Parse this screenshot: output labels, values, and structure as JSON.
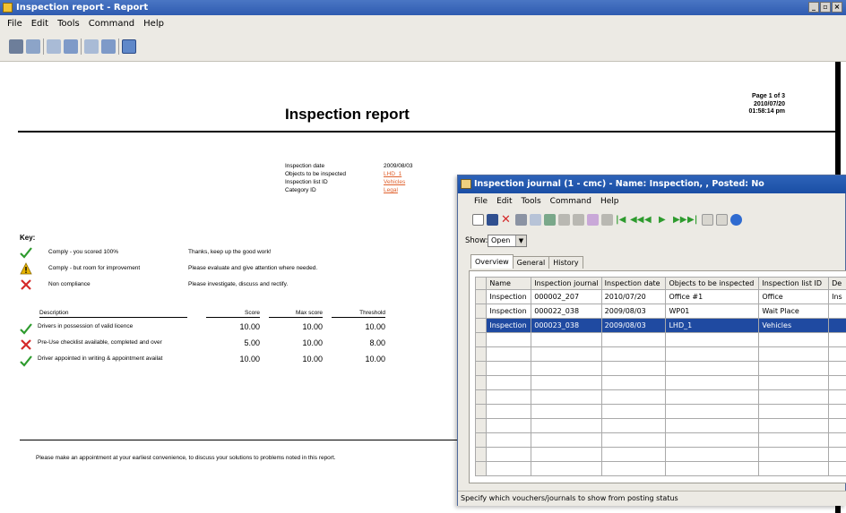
{
  "report_window": {
    "title": "Inspection report - Report",
    "menu": [
      "File",
      "Edit",
      "Tools",
      "Command",
      "Help"
    ],
    "report": {
      "title": "Inspection report",
      "page_info": [
        "Page 1 of  3",
        "2010/07/20",
        "01:58:14 pm"
      ],
      "meta": [
        {
          "label": "Inspection date",
          "value": "2009/08/03",
          "link": false
        },
        {
          "label": "Objects to be inspected",
          "value": "LHD_1",
          "link": true
        },
        {
          "label": "Inspection list ID",
          "value": "Vehicles",
          "link": true
        },
        {
          "label": "Category ID",
          "value": "Legal",
          "link": true
        }
      ],
      "key_title": "Key:",
      "key": [
        {
          "icon": "check-icon",
          "label": "Comply - you scored 100%",
          "desc": "Thanks, keep up the good work!"
        },
        {
          "icon": "warning-icon",
          "label": "Comply - but room for improvement",
          "desc": "Please evaluate and give attention where needed."
        },
        {
          "icon": "x-icon",
          "label": "Non compliance",
          "desc": "Please investigate, discuss and rectify."
        }
      ],
      "score_headers": {
        "description": "Description",
        "score": "Score",
        "max": "Max score",
        "threshold": "Threshold"
      },
      "scores": [
        {
          "icon": "check-icon",
          "description": "Drivers in possession of valid licence",
          "score": "10.00",
          "max": "10.00",
          "threshold": "10.00"
        },
        {
          "icon": "x-icon",
          "description": "Pre-Use checklist available, completed and over",
          "score": "5.00",
          "max": "10.00",
          "threshold": "8.00"
        },
        {
          "icon": "check-icon",
          "description": "Driver appointed in writing & appointment availat",
          "score": "10.00",
          "max": "10.00",
          "threshold": "10.00"
        }
      ],
      "footer": "Please make an appointment at your earliest convenience, to discuss your solutions to problems noted in this report."
    }
  },
  "journal_window": {
    "title": "Inspection journal (1 - cmc) - Name: Inspection, , Posted: No",
    "menu": [
      "File",
      "Edit",
      "Tools",
      "Command",
      "Help"
    ],
    "show_label": "Show:",
    "show_value": "Open",
    "tabs": [
      "Overview",
      "General",
      "History"
    ],
    "columns": [
      "Name",
      "Inspection journal",
      "Inspection date",
      "Objects to be inspected",
      "Inspection list ID",
      "De"
    ],
    "rows": [
      [
        "Inspection",
        "000002_207",
        "2010/07/20",
        "Office #1",
        "Office",
        "Ins"
      ],
      [
        "Inspection",
        "000022_038",
        "2009/08/03",
        "WP01",
        "Wait Place",
        ""
      ],
      [
        "Inspection",
        "000023_038",
        "2009/08/03",
        "LHD_1",
        "Vehicles",
        ""
      ]
    ],
    "selected_row": 2,
    "empty_rows": 10,
    "status": "Specify which vouchers/journals to show from posting status"
  },
  "colors": {
    "titlebar": "#2f5bb0",
    "selection": "#1f4aa1",
    "link": "#e0612d",
    "check": "#2e9b2e",
    "x": "#d42a2a",
    "warning": "#e8b400"
  }
}
